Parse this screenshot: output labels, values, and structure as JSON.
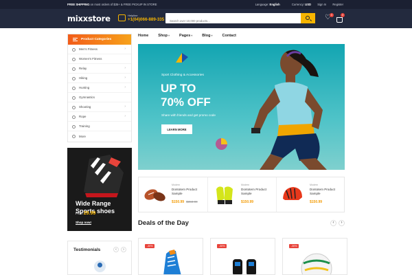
{
  "topbar": {
    "shipping_bold": "FREE SHIPPING",
    "shipping_rest": " on most orders of $35+ & FREE PICKUP IN STORE",
    "language_label": "Language:",
    "language_value": "English",
    "currency_label": "Currency:",
    "currency_value": "USD",
    "signin": "Sign In",
    "register": "Register"
  },
  "header": {
    "logo": "mixxstore",
    "helpline_label": "Helpline",
    "helpline_number": "+1(04)066-889-335",
    "search_placeholder": "Search over 10,000 products...",
    "wishlist_count": "0",
    "cart_count": "0"
  },
  "sidebar": {
    "title": "Product Categories",
    "items": [
      {
        "label": "Men's Fitness",
        "icon": "tshirt-icon",
        "has_sub": true
      },
      {
        "label": "Women's Fitness",
        "icon": "dress-icon",
        "has_sub": false
      },
      {
        "label": "Relay",
        "icon": "relay-icon",
        "has_sub": true
      },
      {
        "label": "Hiking",
        "icon": "hiking-icon",
        "has_sub": true
      },
      {
        "label": "Hunting",
        "icon": "hunting-icon",
        "has_sub": true
      },
      {
        "label": "Gymnastics",
        "icon": "gymnastics-icon",
        "has_sub": false
      },
      {
        "label": "Shooting",
        "icon": "shooting-icon",
        "has_sub": true
      },
      {
        "label": "Rope",
        "icon": "rope-icon",
        "has_sub": true
      },
      {
        "label": "Training",
        "icon": "training-icon",
        "has_sub": false
      },
      {
        "label": "More",
        "icon": "plus-icon",
        "has_sub": false
      }
    ]
  },
  "side_banner": {
    "title": "Wide Range Sports shoes",
    "from_label": "From",
    "price": "29.99",
    "cta": "Shop now!"
  },
  "testimonials": {
    "title": "Testimonials"
  },
  "nav": {
    "items": [
      {
        "label": "Home",
        "caret": false
      },
      {
        "label": "Shop",
        "caret": true
      },
      {
        "label": "Pages",
        "caret": true
      },
      {
        "label": "Blog",
        "caret": true
      },
      {
        "label": "Contact",
        "caret": false
      }
    ]
  },
  "hero": {
    "kicker": "Sport Clothing & Accessories",
    "headline": "UP TO\n70% OFF",
    "sub": "Share with friends and get promo code",
    "cta": "LEARN MORE"
  },
  "products": [
    {
      "category": "Modern",
      "name": "Dontotem Product Sample",
      "price": "$150.99",
      "old_price": "$350.99"
    },
    {
      "category": "Modern",
      "name": "Dontotem Product Sample",
      "price": "$150.99",
      "old_price": ""
    },
    {
      "category": "Modern",
      "name": "Dontotem Product Sample",
      "price": "$150.99",
      "old_price": ""
    }
  ],
  "deals": {
    "title": "Deals of the Day",
    "items": [
      {
        "badge": "-30%"
      },
      {
        "badge": "-30%"
      },
      {
        "badge": "-30%"
      }
    ]
  },
  "colors": {
    "topbar_bg": "#1b2032",
    "header_bg": "#232a3e",
    "accent": "#f7b500",
    "category_gradient_start": "#f25c19",
    "hero_bg": "#13a5b2",
    "sale_badge": "#e8443b"
  }
}
